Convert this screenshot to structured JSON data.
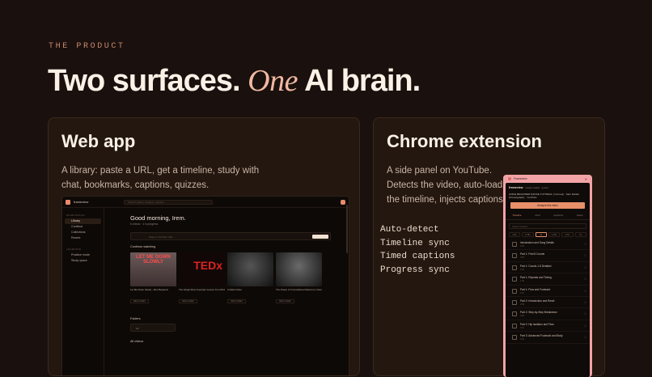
{
  "eyebrow": "THE PRODUCT",
  "headline": {
    "part1": "Two surfaces.",
    "accent": "One",
    "part2": "AI brain."
  },
  "web_card": {
    "title": "Web app",
    "description": "A library: paste a URL, get a timeline, study with chat, bookmarks, captions, quizzes.",
    "mock": {
      "brand": "frameview",
      "search_placeholder": "Search videos, chapters, quizzes…",
      "sidebar": {
        "sections": [
          {
            "label": "WORKSPACE",
            "items": [
              "Library",
              "Continue",
              "Collections",
              "Recent"
            ]
          },
          {
            "label": "LEARNING",
            "items": [
              "Practice mode",
              "Study space"
            ]
          }
        ],
        "active": "Library"
      },
      "greeting": "Good morning, Irem.",
      "subgreeting": "6 videos · 4 in progress",
      "paste_placeholder": "Paste a YouTube URL…",
      "continue_label": "Continue watching",
      "thumbs": [
        {
          "overlay": "LET ME DOWN SLOWLY",
          "caption": "Let Me Down Slowly - Alec Benjamin",
          "button": "Add to folder"
        },
        {
          "overlay": "TEDx",
          "caption": "The Single Most Important Lesson from 83,000 Brain Scans | Daniel Amen | TEDx",
          "button": "Add to folder"
        },
        {
          "overlay": "",
          "caption": "Untitled Video",
          "button": "Add to folder"
        },
        {
          "overlay": "",
          "caption": "The Power of Unconditional Welcome | Karen Faith | TEDxSC",
          "button": "Add to folder"
        }
      ],
      "folders_label": "Folders",
      "folder_item": "All",
      "all_videos_label": "All videos"
    }
  },
  "ext_card": {
    "title": "Chrome extension",
    "description": "A side panel on YouTube. Detects the video, auto-loads the timeline, injects captions."
  },
  "features": [
    "Auto-detect",
    "Timeline sync",
    "Timed captions",
    "Progress sync"
  ],
  "ext_mock": {
    "panel_title": "Frameview",
    "close": "✕",
    "brand": "frameview",
    "brand_sub": "timeline loaded · synced",
    "video_title": "(KIDS) BEGINNER DANCE TUTORIAL | Comedy · Sam Mellan Choreography · YouTube",
    "analyze_button": "Analyze this video",
    "tabs": [
      {
        "label": "Timeline",
        "active": true
      },
      {
        "label": "Chat",
        "active": false
      },
      {
        "label": "Captions",
        "active": false
      },
      {
        "label": "Notes",
        "active": false
      }
    ],
    "search_placeholder": "Search timeline",
    "speeds": [
      {
        "label": "0.5x",
        "active": false
      },
      {
        "label": "0.75x",
        "active": false
      },
      {
        "label": "1x",
        "active": true
      },
      {
        "label": "1.25x",
        "active": false
      },
      {
        "label": "1.5x",
        "active": false
      },
      {
        "label": "2x",
        "active": false
      }
    ],
    "chapters": [
      {
        "name": "Introduction and Song Details",
        "time": "0:00"
      },
      {
        "name": "Part 1: First 8 Counts",
        "time": "0:30"
      },
      {
        "name": "Part 1: Counts 1-8 Detailed",
        "time": "1:02"
      },
      {
        "name": "Part 1: Repeats and Timing",
        "time": "1:40"
      },
      {
        "name": "Part 1: Flow and Footwork",
        "time": "2:15"
      },
      {
        "name": "Part 2: Introduction and Reset",
        "time": "2:58"
      },
      {
        "name": "Part 2: Step-by-Step Breakdown",
        "time": "3:30"
      },
      {
        "name": "Part 2: Hip Isolation and Flow",
        "time": "4:10"
      },
      {
        "name": "Part 3: Advanced Footwork and Body",
        "time": "4:52"
      }
    ]
  }
}
